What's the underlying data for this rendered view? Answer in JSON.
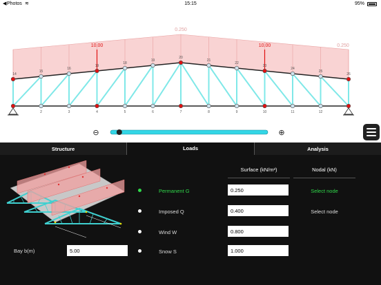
{
  "statusbar": {
    "back_glyph": "◀",
    "app": "Photos",
    "wifi_glyph": "≋",
    "time": "15:15",
    "battery": "95%"
  },
  "truss": {
    "load_labels": {
      "left_end": "",
      "peak": "0.250",
      "right_end": "0.250",
      "point_left": "10.00",
      "point_right": "10.00"
    },
    "top_nodes": [
      "14",
      "15",
      "16",
      "19",
      "18",
      "19",
      "20",
      "21",
      "22",
      "23",
      "24",
      "25",
      "26"
    ],
    "bottom_nodes": [
      "1",
      "2",
      "3",
      "4",
      "5",
      "6",
      "7",
      "8",
      "9",
      "10",
      "11",
      "12",
      "13"
    ]
  },
  "slider": {
    "value": 0.03
  },
  "tabs": {
    "structure": "Structure",
    "loads": "Loads",
    "analysis": "Analysis"
  },
  "loads": {
    "header_surface": "Surface (kN/m²)",
    "header_nodal": "Nodal (kN)",
    "rows": [
      {
        "label": "Permanent G",
        "value": "0.250",
        "nodal": "Select node",
        "active": true
      },
      {
        "label": "Imposed Q",
        "value": "0.400",
        "nodal": "Select node",
        "active": false
      },
      {
        "label": "Wind W",
        "value": "0.800",
        "nodal": "",
        "active": false
      },
      {
        "label": "Snow S",
        "value": "1.000",
        "nodal": "",
        "active": false
      }
    ],
    "bay_label": "Bay b(m)",
    "bay_value": "5.00"
  },
  "colors": {
    "member": "#7fe8e8",
    "chord": "#222222",
    "load_fill": "#f7c8c8",
    "point_load": "#e01010",
    "active_green": "#2fd84a",
    "slider": "#33d6e6"
  }
}
